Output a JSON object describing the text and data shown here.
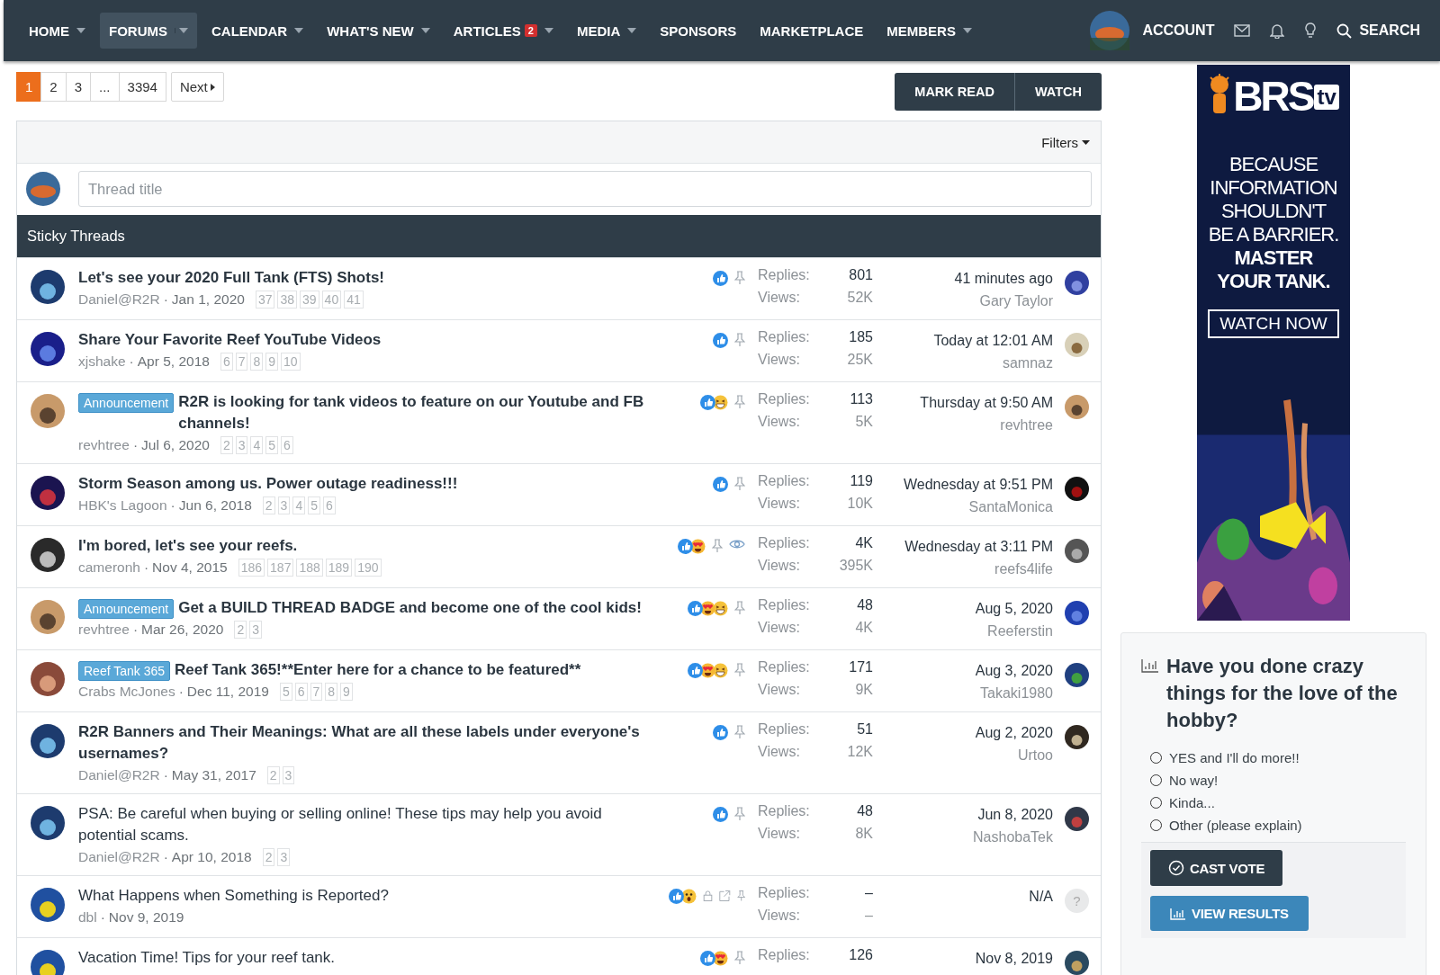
{
  "nav": {
    "items": [
      {
        "label": "HOME",
        "selected": false,
        "dropdown": true
      },
      {
        "label": "FORUMS",
        "selected": true,
        "dropdown": true
      },
      {
        "label": "CALENDAR",
        "selected": false,
        "dropdown": true
      },
      {
        "label": "WHAT'S NEW",
        "selected": false,
        "dropdown": true
      },
      {
        "label": "ARTICLES",
        "selected": false,
        "dropdown": true,
        "badge": "2"
      },
      {
        "label": "MEDIA",
        "selected": false,
        "dropdown": true
      },
      {
        "label": "SPONSORS",
        "selected": false,
        "dropdown": false
      },
      {
        "label": "MARKETPLACE",
        "selected": false,
        "dropdown": false
      },
      {
        "label": "MEMBERS",
        "selected": false,
        "dropdown": true
      }
    ],
    "account": "ACCOUNT",
    "search": "SEARCH"
  },
  "pagination": {
    "pages": [
      {
        "label": "1",
        "selected": true
      },
      {
        "label": "2",
        "selected": false
      },
      {
        "label": "3",
        "selected": false
      },
      {
        "label": "...",
        "selected": false
      },
      {
        "label": "3394",
        "selected": false
      }
    ],
    "next": "Next"
  },
  "actions": [
    "MARK READ",
    "WATCH"
  ],
  "filters": "Filters",
  "new_thread": {
    "placeholder": "Thread title"
  },
  "section_title": "Sticky Threads",
  "threads": [
    {
      "title": "Let's see your 2020 Full Tank (FTS) Shots!",
      "unread": true,
      "author": "Daniel@R2R",
      "separator": "·",
      "date": "Jan 1, 2020",
      "pages": [
        "37",
        "38",
        "39",
        "40",
        "41"
      ],
      "reactions": [
        {
          "kind": "like"
        }
      ],
      "icons": [
        {
          "kind": "pin"
        }
      ],
      "replies_label": "Replies:",
      "replies": "801",
      "views_label": "Views:",
      "views": "52K",
      "last_date": "41 minutes ago",
      "last_user": "Gary Taylor"
    },
    {
      "title": "Share Your Favorite Reef YouTube Videos",
      "unread": true,
      "author": "xjshake",
      "separator": "·",
      "date": "Apr 5, 2018",
      "pages": [
        "6",
        "7",
        "8",
        "9",
        "10"
      ],
      "reactions": [
        {
          "kind": "like"
        }
      ],
      "icons": [
        {
          "kind": "pin"
        }
      ],
      "replies_label": "Replies:",
      "replies": "185",
      "views_label": "Views:",
      "views": "25K",
      "last_date": "Today at 12:01 AM",
      "last_user": "samnaz"
    },
    {
      "prefix": "Announcement",
      "title": "R2R is looking for tank videos to feature on our Youtube and FB channels!",
      "unread": true,
      "author": "revhtree",
      "separator": "·",
      "date": "Jul 6, 2020",
      "pages": [
        "2",
        "3",
        "4",
        "5",
        "6"
      ],
      "reactions": [
        {
          "kind": "like"
        },
        {
          "kind": "laugh"
        }
      ],
      "icons": [
        {
          "kind": "pin"
        }
      ],
      "replies_label": "Replies:",
      "replies": "113",
      "views_label": "Views:",
      "views": "5K",
      "last_date": "Thursday at 9:50 AM",
      "last_user": "revhtree"
    },
    {
      "title": "Storm Season among us. Power outage readiness!!!",
      "unread": true,
      "author": "HBK's Lagoon",
      "separator": "·",
      "date": "Jun 6, 2018",
      "pages": [
        "2",
        "3",
        "4",
        "5",
        "6"
      ],
      "reactions": [
        {
          "kind": "like"
        }
      ],
      "icons": [
        {
          "kind": "pin"
        }
      ],
      "replies_label": "Replies:",
      "replies": "119",
      "views_label": "Views:",
      "views": "10K",
      "last_date": "Wednesday at 9:51 PM",
      "last_user": "SantaMonica"
    },
    {
      "title": "I'm bored, let's see your reefs.",
      "unread": true,
      "author": "cameronh",
      "separator": "·",
      "date": "Nov 4, 2015",
      "pages": [
        "186",
        "187",
        "188",
        "189",
        "190"
      ],
      "reactions": [
        {
          "kind": "like"
        },
        {
          "kind": "love"
        }
      ],
      "icons": [
        {
          "kind": "pin"
        },
        {
          "kind": "watch"
        }
      ],
      "replies_label": "Replies:",
      "replies": "4K",
      "views_label": "Views:",
      "views": "395K",
      "last_date": "Wednesday at 3:11 PM",
      "last_user": "reefs4life"
    },
    {
      "prefix": "Announcement",
      "title": "Get a BUILD THREAD BADGE and become one of the cool kids!",
      "unread": true,
      "author": "revhtree",
      "separator": "·",
      "date": "Mar 26, 2020",
      "pages": [
        "2",
        "3"
      ],
      "reactions": [
        {
          "kind": "like"
        },
        {
          "kind": "love"
        },
        {
          "kind": "laugh"
        }
      ],
      "icons": [
        {
          "kind": "pin"
        }
      ],
      "replies_label": "Replies:",
      "replies": "48",
      "views_label": "Views:",
      "views": "4K",
      "last_date": "Aug 5, 2020",
      "last_user": "Reeferstin"
    },
    {
      "prefix": "Reef Tank 365",
      "title": "Reef Tank 365!**Enter here for a chance to be featured**",
      "unread": true,
      "author": "Crabs McJones",
      "separator": "·",
      "date": "Dec 11, 2019",
      "pages": [
        "5",
        "6",
        "7",
        "8",
        "9"
      ],
      "reactions": [
        {
          "kind": "like"
        },
        {
          "kind": "love"
        },
        {
          "kind": "laugh"
        }
      ],
      "icons": [
        {
          "kind": "pin"
        }
      ],
      "replies_label": "Replies:",
      "replies": "171",
      "views_label": "Views:",
      "views": "9K",
      "last_date": "Aug 3, 2020",
      "last_user": "Takaki1980"
    },
    {
      "title": "R2R Banners and Their Meanings: What are all these labels under everyone's usernames?",
      "unread": true,
      "author": "Daniel@R2R",
      "separator": "·",
      "date": "May 31, 2017",
      "pages": [
        "2",
        "3"
      ],
      "reactions": [
        {
          "kind": "like"
        }
      ],
      "icons": [
        {
          "kind": "pin"
        }
      ],
      "replies_label": "Replies:",
      "replies": "51",
      "views_label": "Views:",
      "views": "12K",
      "last_date": "Aug 2, 2020",
      "last_user": "Urtoo"
    },
    {
      "title": "PSA: Be careful when buying or selling online! These tips may help you avoid potential scams.",
      "unread": false,
      "author": "Daniel@R2R",
      "separator": "·",
      "date": "Apr 10, 2018",
      "pages": [
        "2",
        "3"
      ],
      "reactions": [
        {
          "kind": "like"
        }
      ],
      "icons": [
        {
          "kind": "pin"
        }
      ],
      "replies_label": "Replies:",
      "replies": "48",
      "views_label": "Views:",
      "views": "8K",
      "last_date": "Jun 8, 2020",
      "last_user": "NashobaTek"
    },
    {
      "title": "What Happens when Something is Reported?",
      "unread": false,
      "author": "dbl",
      "separator": "·",
      "date": "Nov 9, 2019",
      "reactions": [
        {
          "kind": "like"
        },
        {
          "kind": "wow"
        }
      ],
      "icons": [
        {
          "kind": "lock"
        },
        {
          "kind": "redirect"
        },
        {
          "kind": "pin"
        }
      ],
      "replies_label": "Replies:",
      "replies": "–",
      "views_label": "Views:",
      "views": "–",
      "last_date": "N/A",
      "last_avatar": "?"
    },
    {
      "title": "Vacation Time! Tips for your reef tank.",
      "unread": false,
      "reactions": [
        {
          "kind": "like"
        },
        {
          "kind": "love"
        }
      ],
      "icons": [
        {
          "kind": "pin"
        }
      ],
      "replies_label": "Replies:",
      "replies": "126",
      "last_date": "Nov 8, 2019"
    }
  ],
  "ad": {
    "logo": "BRS",
    "logo_tag": "tv",
    "lines": [
      "BECAUSE",
      "INFORMATION",
      "SHOULDN'T",
      "BE A BARRIER."
    ],
    "strong_lines": [
      "MASTER",
      "YOUR TANK."
    ],
    "cta": "WATCH NOW",
    "kind": "picture"
  },
  "poll": {
    "title": "Have you done crazy things for the love of the hobby?",
    "options": [
      {
        "label": "YES and I'll do more!!",
        "selected": false
      },
      {
        "label": "No way!",
        "selected": false
      },
      {
        "label": "Kinda...",
        "selected": false
      },
      {
        "label": "Other (please explain)",
        "selected": false
      }
    ],
    "vote": "CAST VOTE",
    "results": "VIEW RESULTS"
  }
}
